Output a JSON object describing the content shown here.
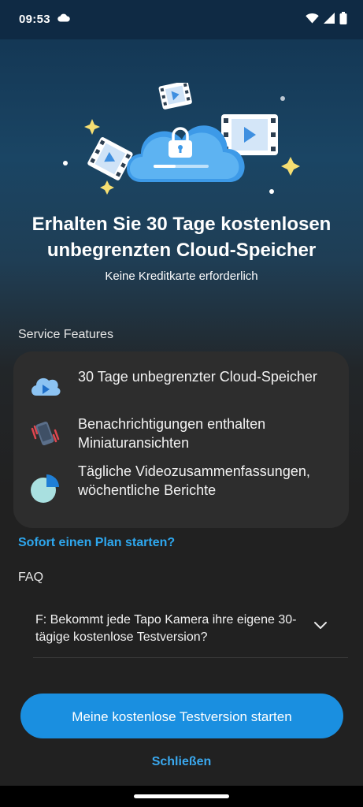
{
  "status_bar": {
    "time": "09:53"
  },
  "headline": "Erhalten Sie 30 Tage kostenlosen unbegrenzten Cloud-Speicher",
  "subline": "Keine Kreditkarte erforderlich",
  "features_section": {
    "title": "Service Features",
    "items": [
      {
        "icon": "cloud-play-icon",
        "label": "30 Tage unbegrenzter Cloud-Speicher"
      },
      {
        "icon": "phone-notification-icon",
        "label": "Benachrichtigungen enthalten Miniaturansichten"
      },
      {
        "icon": "pie-chart-icon",
        "label": "Tägliche Videozusammenfassungen, wöchentliche Berichte"
      }
    ]
  },
  "plan_link": "Sofort einen Plan starten?",
  "faq": {
    "title": "FAQ",
    "question": "F: Bekommt jede Tapo Kamera ihre eigene 30-tägige kostenlose Testversion?"
  },
  "cta_label": "Meine kostenlose Testversion starten",
  "close_label": "Schließen",
  "colors": {
    "accent": "#1a8fe0",
    "link": "#2ea7ee",
    "card": "#2d2d2d"
  }
}
